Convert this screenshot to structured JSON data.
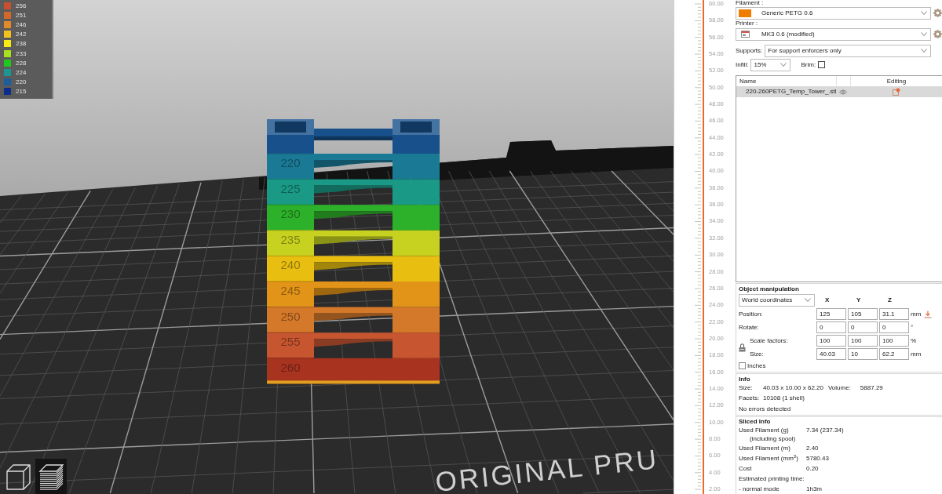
{
  "viewport": {
    "legend": [
      {
        "label": "256",
        "color": "#c8502e"
      },
      {
        "label": "251",
        "color": "#d4672a"
      },
      {
        "label": "246",
        "color": "#e2892a"
      },
      {
        "label": "242",
        "color": "#f2c31c"
      },
      {
        "label": "238",
        "color": "#f5ec16"
      },
      {
        "label": "233",
        "color": "#a6e21e"
      },
      {
        "label": "228",
        "color": "#1ec81e"
      },
      {
        "label": "224",
        "color": "#1c9692"
      },
      {
        "label": "220",
        "color": "#1a5f9c"
      },
      {
        "label": "215",
        "color": "#0c2d8c"
      }
    ],
    "tower": [
      {
        "kind": "cap",
        "color": "#17508a"
      },
      {
        "kind": "band",
        "label": "220",
        "color": "#1a7a96"
      },
      {
        "kind": "band",
        "label": "225",
        "color": "#1a9a86"
      },
      {
        "kind": "band",
        "label": "230",
        "color": "#2db12a"
      },
      {
        "kind": "band",
        "label": "235",
        "color": "#c6d21f"
      },
      {
        "kind": "band",
        "label": "240",
        "color": "#e8bf10"
      },
      {
        "kind": "band",
        "label": "245",
        "color": "#e29418"
      },
      {
        "kind": "band",
        "label": "250",
        "color": "#d4782a"
      },
      {
        "kind": "band",
        "label": "255",
        "color": "#c65530"
      },
      {
        "kind": "base",
        "label": "260",
        "color": "#a83420"
      }
    ],
    "bed_label": "ORIGINAL PRU",
    "view_buttons": [
      {
        "kind": "cube",
        "selected": false
      },
      {
        "kind": "layers",
        "selected": true
      }
    ]
  },
  "layer_ruler": {
    "labels": [
      "60.00",
      "58.00",
      "56.00",
      "54.00",
      "52.00",
      "50.00",
      "48.00",
      "46.00",
      "44.00",
      "42.00",
      "40.00",
      "38.00",
      "36.00",
      "34.00",
      "32.00",
      "30.00",
      "28.00",
      "26.00",
      "24.00",
      "22.00",
      "20.00",
      "18.00",
      "16.00",
      "14.00",
      "12.00",
      "10.00",
      "8.00",
      "6.00",
      "4.00",
      "2.00"
    ]
  },
  "sidebar": {
    "filament": {
      "label": "Filament :",
      "value": "Generic PETG 0.6",
      "color": "#f07d00"
    },
    "printer": {
      "label": "Printer :",
      "value": "MK3 0.6 (modified)"
    },
    "supports": {
      "label": "Supports:",
      "value": "For support enforcers only"
    },
    "infill": {
      "label": "Infill:",
      "value": "15%"
    },
    "brim": {
      "label": "Brim:",
      "checked": false
    },
    "object_list": {
      "name_header": "Name",
      "editing_header": "Editing",
      "rows": [
        {
          "name": "220-260PETG_Temp_Tower_.stl",
          "selected": true
        }
      ]
    },
    "object_manipulation": {
      "title": "Object manipulation",
      "coordinates": "World coordinates",
      "axes": [
        "X",
        "Y",
        "Z"
      ],
      "rows": [
        {
          "kind": "move",
          "label": "Position:",
          "values": [
            "125",
            "105",
            "31.1"
          ],
          "unit": "mm"
        },
        {
          "kind": "plain",
          "label": "Rotate:",
          "values": [
            "0",
            "0",
            "0"
          ],
          "unit": "°"
        },
        {
          "kind": "locked",
          "label": "Scale factors:",
          "values": [
            "100",
            "100",
            "100"
          ],
          "unit": "%"
        },
        {
          "kind": "locked",
          "label": "Size:",
          "values": [
            "40.03",
            "10",
            "62.2"
          ],
          "unit": "mm"
        }
      ],
      "inches": {
        "label": "Inches",
        "checked": false
      }
    },
    "info": {
      "title": "Info",
      "size_label": "Size:",
      "size": "40.03 x 10.00 x 62.20",
      "volume_label": "Volume:",
      "volume": "5887.29",
      "facets_label": "Facets:",
      "facets": "10108 (1 shell)",
      "status": "No errors detected"
    },
    "sliced_info": {
      "title": "Sliced Info",
      "rows": [
        {
          "label": "Used Filament (g)",
          "sublabel": "(including spool)",
          "value": "7.34 (237.34)"
        },
        {
          "label": "Used Filament (m)",
          "value": "2.40"
        },
        {
          "label": "Used Filament (mm$^{3}$)",
          "value": "5780.43"
        },
        {
          "label": "Cost",
          "value": "0.20"
        },
        {
          "label": "Estimated printing time:"
        },
        {
          "label": "- normal mode",
          "value": "1h3m"
        }
      ]
    }
  }
}
